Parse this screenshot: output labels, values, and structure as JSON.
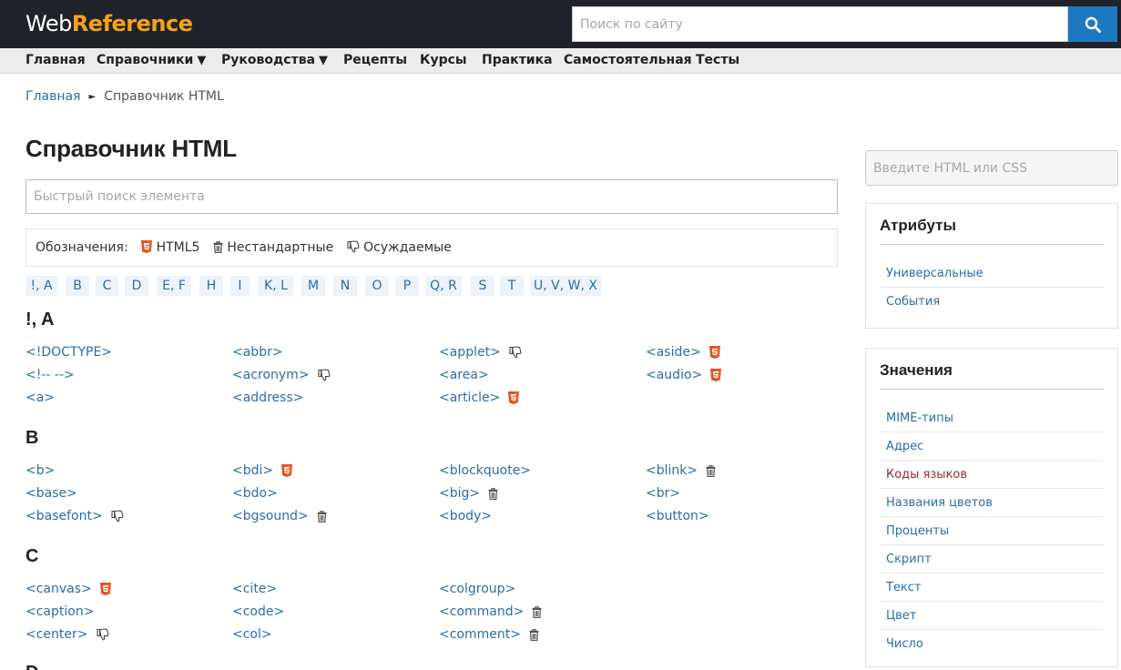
{
  "header": {
    "logo_web": "Web",
    "logo_ref": "Reference",
    "search_placeholder": "Поиск по сайту",
    "brand_color": "#f4a11c",
    "accent_color": "#1d78c1"
  },
  "nav": [
    {
      "label": "Главная",
      "arrow": ""
    },
    {
      "label": "Справочники",
      "arrow": "▼"
    },
    {
      "label": "Руководства",
      "arrow": "▼"
    },
    {
      "label": "Рецепты",
      "arrow": ""
    },
    {
      "label": "Курсы",
      "arrow": ""
    },
    {
      "label": "Практика",
      "arrow": ""
    },
    {
      "label": "Самостоятельная",
      "arrow": ""
    },
    {
      "label": "Тесты",
      "arrow": ""
    }
  ],
  "breadcrumb": {
    "home": "Главная",
    "sep": "►",
    "current": "Справочник HTML"
  },
  "page_title": "Справочник HTML",
  "quick_search_placeholder": "Быстрый поиск элемента",
  "legend": {
    "label": "Обозначения:",
    "html5": "HTML5",
    "nonstandard": "Нестандартные",
    "deprecated": "Осуждаемые"
  },
  "letters": [
    "!, A",
    "B",
    "C",
    "D",
    "E, F",
    "H",
    "I",
    "K, L",
    "M",
    "N",
    "O",
    "P",
    "Q, R",
    "S",
    "T",
    "U, V, W, X"
  ],
  "sections": [
    {
      "title": "!, A",
      "tags": [
        {
          "label": "<!DOCTYPE>",
          "icon": ""
        },
        {
          "label": "<!-- -->",
          "icon": ""
        },
        {
          "label": "<a>",
          "icon": ""
        },
        {
          "label": "<abbr>",
          "icon": ""
        },
        {
          "label": "<acronym>",
          "icon": "deprecated"
        },
        {
          "label": "<address>",
          "icon": ""
        },
        {
          "label": "<applet>",
          "icon": "deprecated"
        },
        {
          "label": "<area>",
          "icon": ""
        },
        {
          "label": "<article>",
          "icon": "html5"
        },
        {
          "label": "<aside>",
          "icon": "html5"
        },
        {
          "label": "<audio>",
          "icon": "html5"
        }
      ]
    },
    {
      "title": "B",
      "tags": [
        {
          "label": "<b>",
          "icon": ""
        },
        {
          "label": "<base>",
          "icon": ""
        },
        {
          "label": "<basefont>",
          "icon": "deprecated"
        },
        {
          "label": "<bdi>",
          "icon": "html5"
        },
        {
          "label": "<bdo>",
          "icon": ""
        },
        {
          "label": "<bgsound>",
          "icon": "nonstandard"
        },
        {
          "label": "<blockquote>",
          "icon": ""
        },
        {
          "label": "<big>",
          "icon": "nonstandard"
        },
        {
          "label": "<body>",
          "icon": ""
        },
        {
          "label": "<blink>",
          "icon": "nonstandard"
        },
        {
          "label": "<br>",
          "icon": ""
        },
        {
          "label": "<button>",
          "icon": ""
        }
      ]
    },
    {
      "title": "C",
      "tags": [
        {
          "label": "<canvas>",
          "icon": "html5"
        },
        {
          "label": "<caption>",
          "icon": ""
        },
        {
          "label": "<center>",
          "icon": "deprecated"
        },
        {
          "label": "<cite>",
          "icon": ""
        },
        {
          "label": "<code>",
          "icon": ""
        },
        {
          "label": "<col>",
          "icon": ""
        },
        {
          "label": "<colgroup>",
          "icon": ""
        },
        {
          "label": "<command>",
          "icon": "nonstandard"
        },
        {
          "label": "<comment>",
          "icon": "nonstandard"
        }
      ]
    },
    {
      "title": "D",
      "tags": []
    }
  ],
  "sidebar": {
    "search_placeholder": "Введите HTML или CSS",
    "attributes_title": "Атрибуты",
    "attributes": [
      "Универсальные",
      "События"
    ],
    "values_title": "Значения",
    "values": [
      "MIME-типы",
      "Адрес",
      "Коды языков",
      "Названия цветов",
      "Проценты",
      "Скрипт",
      "Текст",
      "Цвет",
      "Число"
    ],
    "values_active": "Коды языков"
  }
}
